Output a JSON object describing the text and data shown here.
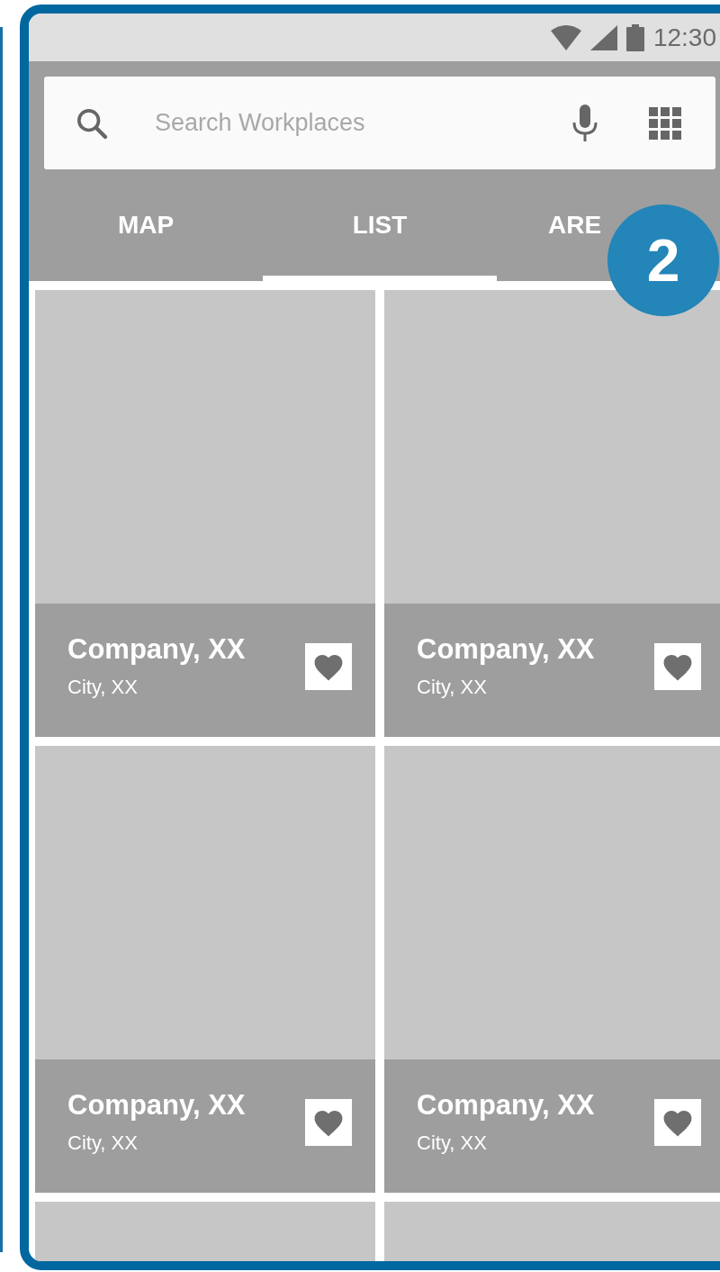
{
  "status_bar": {
    "time": "12:30"
  },
  "search": {
    "placeholder": "Search Workplaces"
  },
  "tabs": [
    {
      "label": "MAP",
      "selected": false
    },
    {
      "label": "LIST",
      "selected": true
    },
    {
      "label": "ARE",
      "selected": false
    }
  ],
  "badge": "2",
  "cards": [
    {
      "title": "Company, XX",
      "subtitle": "City, XX"
    },
    {
      "title": "Company, XX",
      "subtitle": "City, XX"
    },
    {
      "title": "Company, XX",
      "subtitle": "City, XX"
    },
    {
      "title": "Company, XX",
      "subtitle": "City, XX"
    }
  ]
}
